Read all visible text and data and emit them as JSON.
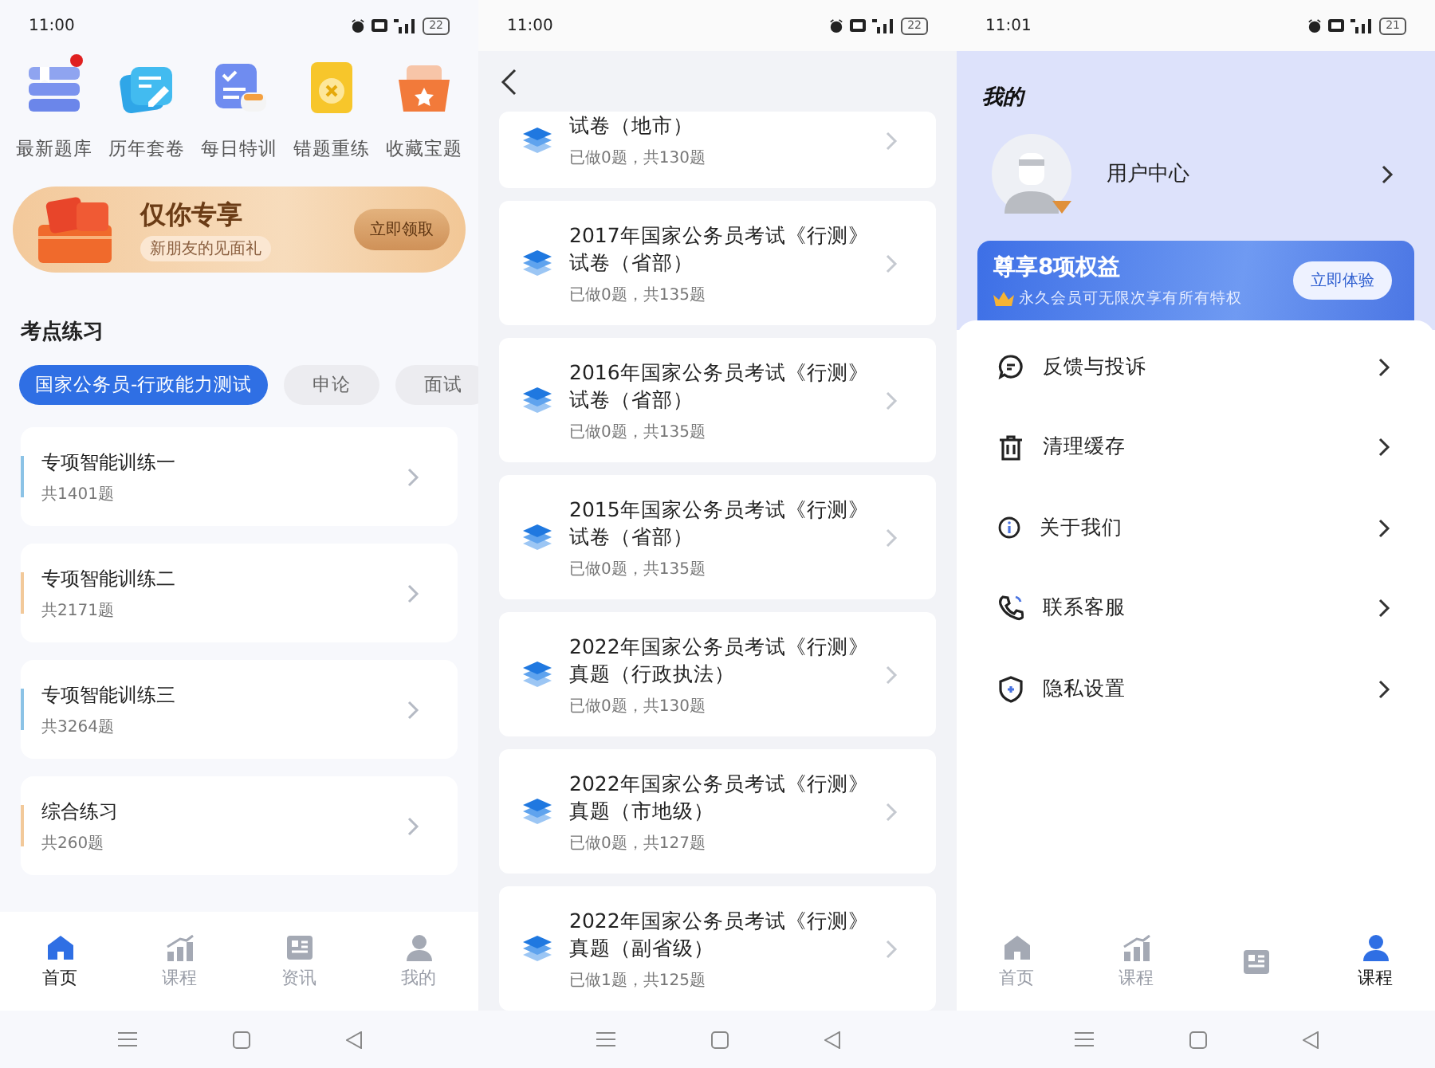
{
  "home_screen": {
    "status_bar": {
      "time": "11:00",
      "battery": "22"
    },
    "shortcuts": [
      {
        "label": "最新题库",
        "badge": true
      },
      {
        "label": "历年套卷",
        "badge": false
      },
      {
        "label": "每日特训",
        "badge": false
      },
      {
        "label": "错题重练",
        "badge": false
      },
      {
        "label": "收藏宝题",
        "badge": false
      }
    ],
    "banner": {
      "title": "仅你专享",
      "subtitle": "新朋友的见面礼",
      "button": "立即领取"
    },
    "section_title": "考点练习",
    "chips": [
      {
        "label": "国家公务员-行政能力测试",
        "selected": true
      },
      {
        "label": "申论",
        "selected": false
      },
      {
        "label": "面试",
        "selected": false
      }
    ],
    "practice_items": [
      {
        "title": "专项智能训练一",
        "count": "共1401题",
        "color": "#8cc3e6"
      },
      {
        "title": "专项智能训练二",
        "count": "共2171题",
        "color": "#f2c99a"
      },
      {
        "title": "专项智能训练三",
        "count": "共3264题",
        "color": "#8cc3e6"
      },
      {
        "title": "综合练习",
        "count": "共260题",
        "color": "#f2c99a"
      }
    ],
    "tab_bar": [
      {
        "label": "首页",
        "selected": true
      },
      {
        "label": "课程",
        "selected": false
      },
      {
        "label": "资讯",
        "selected": false
      },
      {
        "label": "我的",
        "selected": false
      }
    ]
  },
  "list_screen": {
    "status_bar": {
      "time": "11:00",
      "battery": "22"
    },
    "papers": [
      {
        "title": "试卷（地市）",
        "progress": "已做0题，共130题"
      },
      {
        "title": "2017年国家公务员考试《行测》试卷（省部）",
        "progress": "已做0题，共135题"
      },
      {
        "title": "2016年国家公务员考试《行测》试卷（省部）",
        "progress": "已做0题，共135题"
      },
      {
        "title": "2015年国家公务员考试《行测》试卷（省部）",
        "progress": "已做0题，共135题"
      },
      {
        "title": "2022年国家公务员考试《行测》真题（行政执法）",
        "progress": "已做0题，共130题"
      },
      {
        "title": "2022年国家公务员考试《行测》真题（市地级）",
        "progress": "已做0题，共127题"
      },
      {
        "title": "2022年国家公务员考试《行测》真题（副省级）",
        "progress": "已做1题，共125题"
      }
    ]
  },
  "profile_screen": {
    "status_bar": {
      "time": "11:01",
      "battery": "21"
    },
    "title": "我的",
    "user_label": "用户中心",
    "vip_card": {
      "title": "尊享8项权益",
      "subtitle": "永久会员可无限次享有所有特权",
      "button": "立即体验"
    },
    "menu": [
      {
        "label": "反馈与投诉"
      },
      {
        "label": "清理缓存"
      },
      {
        "label": "关于我们"
      },
      {
        "label": "联系客服"
      },
      {
        "label": "隐私设置"
      }
    ],
    "tab_bar": [
      {
        "label": "首页",
        "selected": false
      },
      {
        "label": "课程",
        "selected": false
      },
      {
        "selected": false
      },
      {
        "label": "课程",
        "selected": true
      }
    ]
  }
}
